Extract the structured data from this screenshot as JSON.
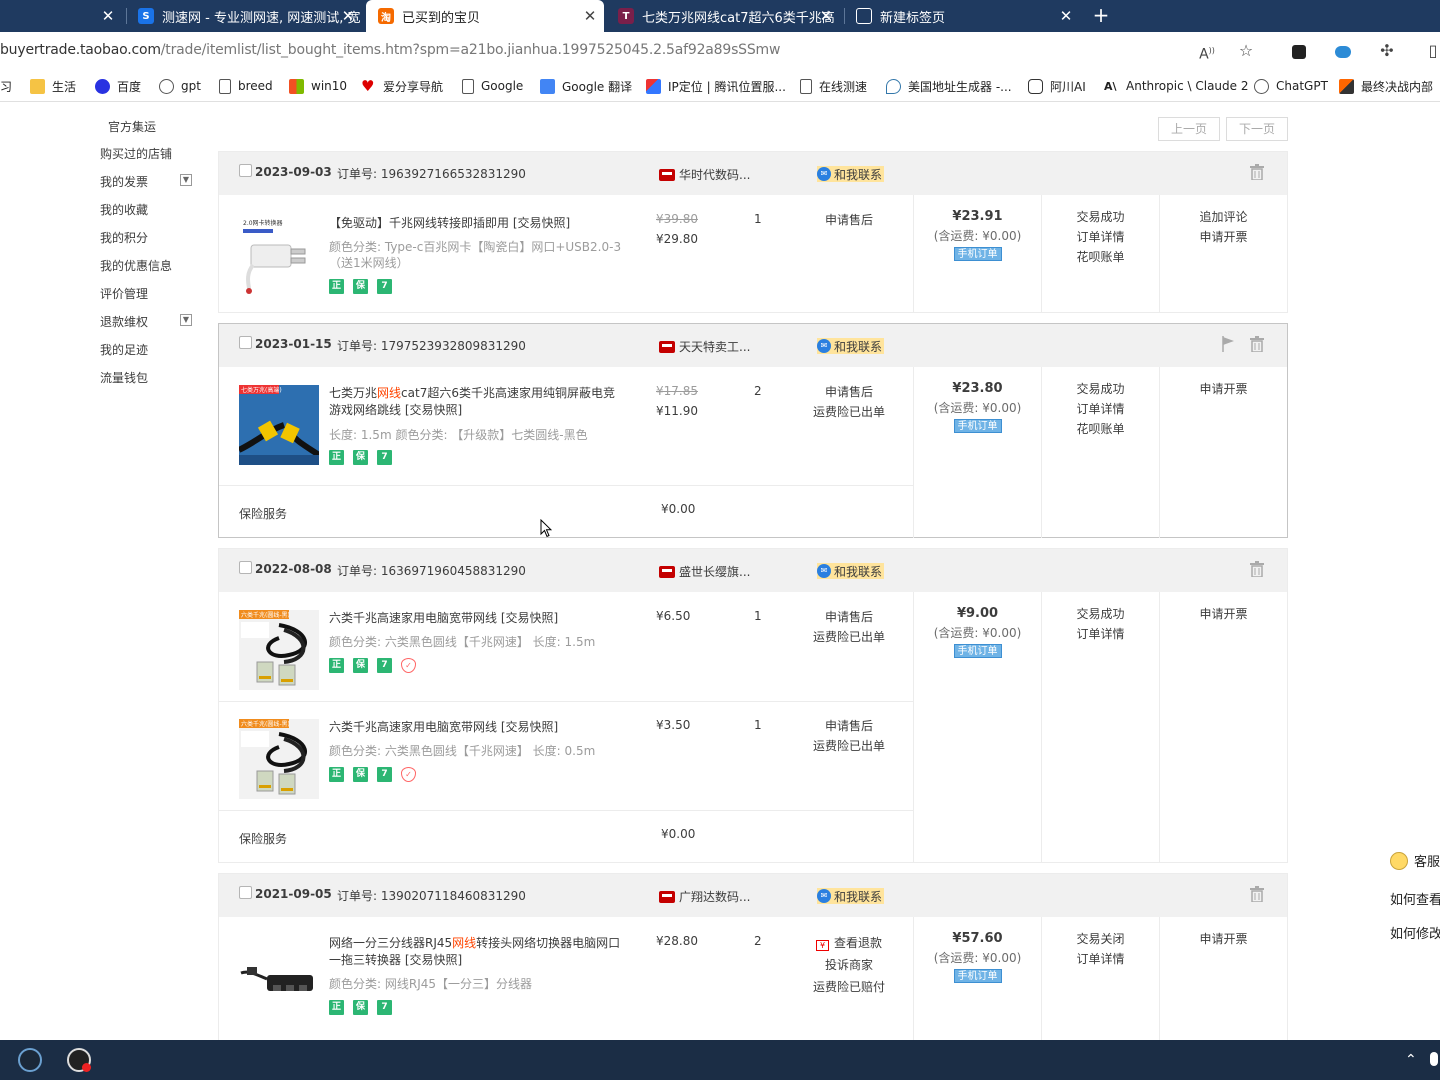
{
  "browser": {
    "tabs": [
      {
        "title": "",
        "icon": "tab-icon",
        "active": false
      },
      {
        "title": "测速网 - 专业测网速, 网速测试, 宽",
        "icon": "speedtest-icon",
        "active": false
      },
      {
        "title": "已买到的宝贝",
        "icon": "taobao-icon",
        "active": true
      },
      {
        "title": "七类万兆网线cat7超六6类千兆高",
        "icon": "tmall-icon",
        "active": false
      },
      {
        "title": "新建标签页",
        "icon": "newtab-icon",
        "active": false
      }
    ],
    "url_host": "buyertrade.taobao.com",
    "url_path": "/trade/itemlist/list_bought_items.htm?spm=a21bo.jianhua.1997525045.2.5af92a89sSSmw",
    "bookmarks": [
      "学习",
      "生活",
      "百度",
      "gpt",
      "breed",
      "win10",
      "爱分享导航",
      "Google",
      "Google 翻译",
      "IP定位 | 腾讯位置服...",
      "在线测速",
      "美国地址生成器 -...",
      "阿川AI",
      "Anthropic \\ Claude 2",
      "ChatGPT",
      "最终决战内部"
    ]
  },
  "sidenav": {
    "items": [
      "官方集运",
      "购买过的店铺",
      "我的发票",
      "我的收藏",
      "我的积分",
      "我的优惠信息",
      "评价管理",
      "退款维权",
      "我的足迹",
      "流量钱包"
    ]
  },
  "pager": {
    "prev": "上一页",
    "next": "下一页"
  },
  "labels": {
    "order_no_prefix": "订单号: ",
    "contact": "和我联系",
    "ship_fee": "(含运费: ¥0.00)",
    "mobile_order": "手机订单",
    "insurance": "保险服务",
    "insurance_price": "¥0.00"
  },
  "orders": [
    {
      "date": "2023-09-03",
      "order_no": "1963927166532831290",
      "shop": "华时代数码...",
      "total": "¥23.91",
      "status": [
        "交易成功",
        "订单详情",
        "花呗账单"
      ],
      "ops": [
        "追加评论",
        "申请开票"
      ],
      "items": [
        {
          "title": "【免驱动】千兆网线转接即插即用 [交易快照]",
          "sku": "颜色分类: Type-c百兆网卡【陶瓷白】网口+USB2.0-3（送1米网线）",
          "price_old": "¥39.80",
          "price": "¥29.80",
          "qty": "1",
          "aftersale": [
            "申请售后"
          ]
        }
      ]
    },
    {
      "date": "2023-01-15",
      "order_no": "1797523932809831290",
      "shop": "天天特卖工...",
      "total": "¥23.80",
      "status": [
        "交易成功",
        "订单详情",
        "花呗账单"
      ],
      "ops": [
        "申请开票"
      ],
      "items": [
        {
          "title_pre": "七类万兆",
          "title_red": "网线",
          "title_post": "cat7超六6类千兆高速家用纯铜屏蔽电竞游戏网络跳线 [交易快照]",
          "sku": "长度: 1.5m  颜色分类: 【升级款】七类圆线-黑色",
          "price_old": "¥17.85",
          "price": "¥11.90",
          "qty": "2",
          "aftersale": [
            "申请售后",
            "运费险已出单"
          ]
        }
      ]
    },
    {
      "date": "2022-08-08",
      "order_no": "1636971960458831290",
      "shop": "盛世长缨旗...",
      "total": "¥9.00",
      "status": [
        "交易成功",
        "订单详情"
      ],
      "ops": [
        "申请开票"
      ],
      "items": [
        {
          "title": "六类千兆高速家用电脑宽带网线 [交易快照]",
          "sku": "颜色分类: 六类黑色圆线【千兆网速】  长度: 1.5m",
          "price": "¥6.50",
          "qty": "1",
          "aftersale": [
            "申请售后",
            "运费险已出单"
          ]
        },
        {
          "title": "六类千兆高速家用电脑宽带网线 [交易快照]",
          "sku": "颜色分类: 六类黑色圆线【千兆网速】  长度: 0.5m",
          "price": "¥3.50",
          "qty": "1",
          "aftersale": [
            "申请售后",
            "运费险已出单"
          ]
        }
      ]
    },
    {
      "date": "2021-09-05",
      "order_no": "1390207118460831290",
      "shop": "广翔达数码...",
      "total": "¥57.60",
      "status": [
        "交易关闭",
        "订单详情"
      ],
      "ops": [
        "申请开票"
      ],
      "items": [
        {
          "title_pre": "网络一分三分线器RJ45",
          "title_red": "网线",
          "title_post": "转接头网络切换器电脑网口一拖三转换器 [交易快照]",
          "sku": "颜色分类: 网线RJ45【一分三】分线器",
          "price": "¥28.80",
          "qty": "2",
          "aftersale": [
            "查看退款",
            "投诉商家",
            "运费险已赔付"
          ]
        }
      ]
    }
  ],
  "help": {
    "title": "客服",
    "q1": "如何查看",
    "q2": "如何修改"
  },
  "thumb_labels": {
    "t1": "2.0网卡转换器",
    "t2": "七类万兆(高端)",
    "t3": "六类千兆(圆线-黑)"
  }
}
